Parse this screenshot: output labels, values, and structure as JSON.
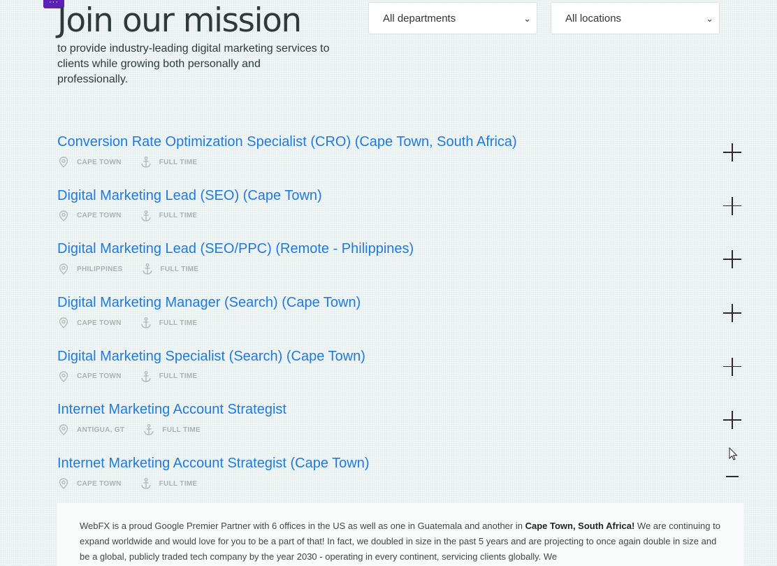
{
  "menu_badge": "···",
  "hero": {
    "title": "Join our mission",
    "subtitle": "to provide industry-leading digital marketing services to clients while growing both personally and professionally."
  },
  "filters": {
    "department": "All departments",
    "location": "All locations"
  },
  "jobs": [
    {
      "title": "Conversion Rate Optimization Specialist (CRO) (Cape Town, South Africa)",
      "location": "CAPE TOWN",
      "type": "FULL TIME",
      "expanded": false
    },
    {
      "title": "Digital Marketing Lead (SEO) (Cape Town)",
      "location": "CAPE TOWN",
      "type": "FULL TIME",
      "expanded": false
    },
    {
      "title": "Digital Marketing Lead (SEO/PPC) (Remote - Philippines)",
      "location": "PHILIPPINES",
      "type": "FULL TIME",
      "expanded": false
    },
    {
      "title": "Digital Marketing Manager (Search) (Cape Town)",
      "location": "CAPE TOWN",
      "type": "FULL TIME",
      "expanded": false
    },
    {
      "title": "Digital Marketing Specialist (Search) (Cape Town)",
      "location": "CAPE TOWN",
      "type": "FULL TIME",
      "expanded": false
    },
    {
      "title": "Internet Marketing Account Strategist",
      "location": "ANTIGUA, GT",
      "type": "FULL TIME",
      "expanded": false
    },
    {
      "title": "Internet Marketing Account Strategist (Cape Town)",
      "location": "CAPE TOWN",
      "type": "FULL TIME",
      "expanded": true
    }
  ],
  "detail": {
    "part1": "WebFX is a proud Google Premier Partner with 6 offices in the US as well as one in Guatemala and another in ",
    "bold": "Cape Town, South Africa!",
    "part2": " We are continuing to expand worldwide and would love for you to be a part of that! In fact, we doubled in size in the past 5 years and are projecting to once again double in size and be a global, publicly traded tech company by the year 2030 - operating in every continent, servicing clients globally. We"
  },
  "colors": {
    "link": "#1f7ae0",
    "badge": "#5b21b6"
  }
}
